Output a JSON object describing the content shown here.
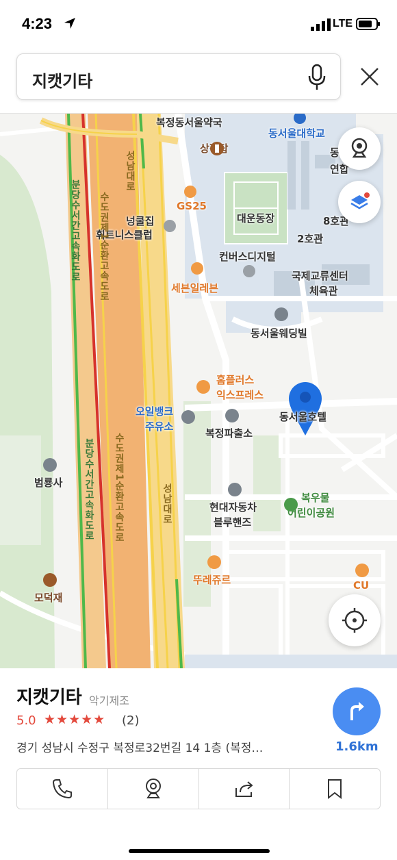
{
  "status_bar": {
    "time": "4:23",
    "network": "LTE"
  },
  "search": {
    "query": "지캣기타"
  },
  "map": {
    "labels": {
      "pharmacy": "복정동서울약국",
      "univ": "동서울대학교",
      "univ2": "동서",
      "univ3": "연합",
      "statue": "상징탑",
      "gs25": "GS25",
      "field": "대운동장",
      "hall8": "8호관",
      "hall2": "2호관",
      "tennis1": "넝쿨집",
      "tennis2": "휘트니스클럽",
      "convers": "컨버스디지털",
      "intl1": "국제교류센터",
      "intl2": "체육관",
      "seven": "세븐일레븐",
      "wedding": "동서울웨딩빌",
      "homeplus1": "홈플러스",
      "homeplus2": "익스프레스",
      "oil1": "오일뱅크",
      "oil2": "주유소",
      "police": "복정파출소",
      "hotel": "동서울호텔",
      "temple": "범룡사",
      "hyundai1": "현대자동차",
      "hyundai2": "블루핸즈",
      "park1": "복우물",
      "park2": "어린이공원",
      "tous": "뚜레쥬르",
      "cu": "CU",
      "modeok": "모덕재",
      "road_bundang": "분당수서간고속화도로",
      "road_bundang2": "분당수서간고속화도로",
      "road_sudo1": "수도권제1순환고속도로",
      "road_sudo2": "수도권제1순환고속도로",
      "road_seongnam1": "성남대로",
      "road_seongnam2": "성남대로"
    }
  },
  "place": {
    "name": "지캣기타",
    "category": "악기제조",
    "rating": "5.0",
    "stars": "★★★★★",
    "review_count": "(2)",
    "address": "경기 성남시 수정구 복정로32번길 14 1층 (복정…",
    "distance": "1.6km"
  },
  "colors": {
    "accent": "#4a8df2",
    "pin": "#1f6fe0",
    "rating": "#e3493c"
  }
}
